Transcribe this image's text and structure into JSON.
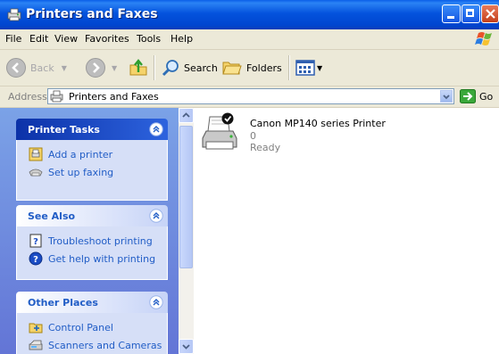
{
  "window": {
    "title": "Printers and Faxes"
  },
  "menu": {
    "items": [
      "File",
      "Edit",
      "View",
      "Favorites",
      "Tools",
      "Help"
    ]
  },
  "toolbar": {
    "back_label": "Back",
    "search_label": "Search",
    "folders_label": "Folders"
  },
  "address": {
    "label": "Address",
    "value": "Printers and Faxes",
    "go_label": "Go"
  },
  "taskpane": {
    "printer_tasks": {
      "title": "Printer Tasks",
      "items": [
        {
          "label": "Add a printer",
          "icon": "add-printer-icon"
        },
        {
          "label": "Set up faxing",
          "icon": "fax-icon"
        }
      ]
    },
    "see_also": {
      "title": "See Also",
      "items": [
        {
          "label": "Troubleshoot printing",
          "icon": "help-book-icon"
        },
        {
          "label": "Get help with printing",
          "icon": "help-circle-icon"
        }
      ]
    },
    "other_places": {
      "title": "Other Places",
      "items": [
        {
          "label": "Control Panel",
          "icon": "control-panel-icon"
        },
        {
          "label": "Scanners and Cameras",
          "icon": "scanner-icon"
        }
      ]
    }
  },
  "printers": [
    {
      "name": "Canon MP140 series Printer",
      "documents": "0",
      "status": "Ready",
      "is_default": true
    }
  ],
  "colors": {
    "titlebar": "#0453dd",
    "taskpane_bg": "#7ba2e7",
    "task_link": "#215dc6",
    "chrome": "#ece9d8"
  }
}
